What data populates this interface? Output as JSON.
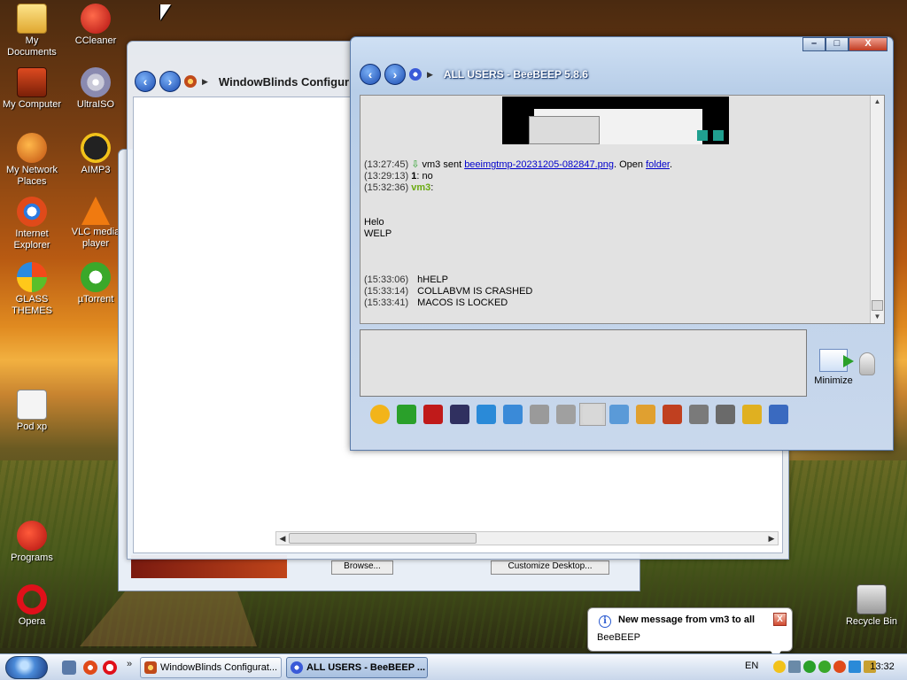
{
  "desktop": {
    "icons": [
      {
        "label": "My Documents",
        "icon": "folder-documents-icon"
      },
      {
        "label": "CCleaner",
        "icon": "ccleaner-icon"
      },
      {
        "label": "My Computer",
        "icon": "computer-icon"
      },
      {
        "label": "UltraISO",
        "icon": "disc-icon"
      },
      {
        "label": "My Network Places",
        "icon": "network-icon"
      },
      {
        "label": "AIMP3",
        "icon": "aimp-icon"
      },
      {
        "label": "Internet Explorer",
        "icon": "internet-explorer-icon"
      },
      {
        "label": "VLC media player",
        "icon": "vlc-cone-icon"
      },
      {
        "label": "GLASS THEMES",
        "icon": "windows-flag-icon"
      },
      {
        "label": "µTorrent",
        "icon": "utorrent-icon"
      },
      {
        "label": "Pod xp",
        "icon": "document-icon"
      },
      {
        "label": "Programs",
        "icon": "programs-icon"
      },
      {
        "label": "Opera",
        "icon": "opera-icon"
      },
      {
        "label": "Recycle Bin",
        "icon": "recycle-bin-icon"
      }
    ]
  },
  "windowblinds": {
    "title": "WindowBlinds Configur",
    "back_window": {
      "button1": "Browse...",
      "button2": "Customize Desktop..."
    }
  },
  "beebeep": {
    "title": "ALL USERS - BeeBEEP 5.8.6",
    "caption": {
      "minimize": "–",
      "maximize": "□",
      "close": "X"
    },
    "chat": {
      "lines": [
        {
          "time": "(13:27:45)",
          "text_before": "vm3 sent ",
          "link": "beeimgtmp-20231205-082847.png",
          "text_mid": ". Open ",
          "link2": "folder",
          "text_after": "."
        },
        {
          "time": "(13:29:13)",
          "user": "1",
          "text": ": no"
        },
        {
          "time": "(15:32:36)",
          "user": "vm3",
          "text": ":"
        }
      ],
      "block": [
        "Helo",
        "WELP"
      ],
      "messages": [
        {
          "time": "(15:33:06)",
          "text": "hHELP"
        },
        {
          "time": "(15:33:14)",
          "text": "COLLABVM IS CRASHED"
        },
        {
          "time": "(15:33:41)",
          "text": "MACOS IS LOCKED"
        }
      ]
    },
    "input": {
      "value": ""
    },
    "send_label": "Minimize",
    "toolbar": [
      {
        "name": "emoticon-icon",
        "color": "#f2b41a"
      },
      {
        "name": "chevron-down-icon",
        "color": "#2aa02a"
      },
      {
        "name": "font-icon",
        "color": "#c01a1a"
      },
      {
        "name": "magic-wand-icon",
        "color": "#303060"
      },
      {
        "name": "filter-icon",
        "color": "#2a8ad8"
      },
      {
        "name": "settings-gear-icon",
        "color": "#3a8ad8"
      },
      {
        "name": "spellcheck-icon",
        "color": "#9a9a9a"
      },
      {
        "name": "text-case-icon",
        "color": "#a0a0a0"
      },
      {
        "name": "music-note-icon",
        "color": "#d8d8d8"
      },
      {
        "name": "send-file-icon",
        "color": "#5a9ad8"
      },
      {
        "name": "send-folder-icon",
        "color": "#e0a030"
      },
      {
        "name": "html-code-icon",
        "color": "#c04020"
      },
      {
        "name": "record-icon",
        "color": "#7a7a7a"
      },
      {
        "name": "screenshot-icon",
        "color": "#6a6a6a"
      },
      {
        "name": "notes-icon",
        "color": "#e0b020"
      },
      {
        "name": "save-icon",
        "color": "#3a6ac0"
      }
    ]
  },
  "notification": {
    "title": "New message from vm3 to all",
    "text": "BeeBEEP",
    "close": "X"
  },
  "taskbar": {
    "more": "»",
    "buttons": [
      {
        "label": "WindowBlinds Configurat...",
        "active": false
      },
      {
        "label": "ALL USERS - BeeBEEP ...",
        "active": true
      }
    ],
    "language": "EN",
    "clock": "13:32"
  },
  "colors": {
    "accent": "#1a4ab0",
    "user_highlight": "#6aaa10",
    "link": "#0000cc"
  }
}
